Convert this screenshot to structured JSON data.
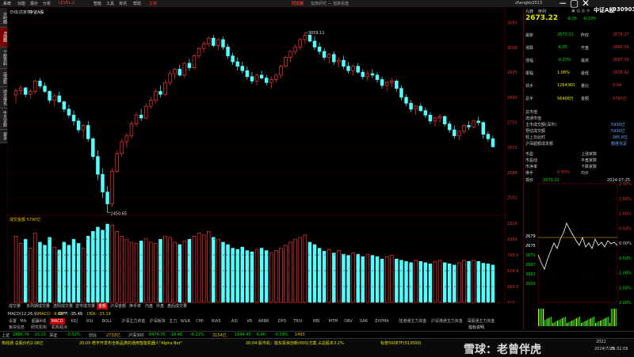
{
  "menubar": {
    "items": [
      "系统",
      "功能",
      "报价",
      "分析",
      "LEVEL-2",
      "智能",
      "工具",
      "资讯",
      "帮助",
      "主菜"
    ],
    "logo": "同花顺",
    "title": "指数研究 — 指数看盘",
    "user": "zhengkb2013",
    "right_tools": [
      "九转",
      "序列"
    ]
  },
  "left_tabs": [
    "分时图",
    "K线图",
    "个股资料",
    "自选股",
    "综合排名",
    "牛叉诊股",
    "更多"
  ],
  "chart": {
    "period_label": "日线(前复权)",
    "index_name": "中证A股",
    "y_ticks": [
      3093,
      3009,
      2925,
      2840,
      2755,
      2671,
      2586,
      2502
    ],
    "ylim": [
      2460,
      3110
    ],
    "high_label": "3059.11",
    "low_label": "2450.65",
    "volume_header": "成交金额 5790亿",
    "vol_ticks": [
      "1316",
      "1056",
      "795.0",
      "529.9",
      "265.0",
      "X10"
    ],
    "candles": [
      [
        2848,
        2870,
        2820,
        2862
      ],
      [
        2862,
        2880,
        2848,
        2872
      ],
      [
        2872,
        2875,
        2840,
        2850
      ],
      [
        2850,
        2868,
        2835,
        2860
      ],
      [
        2860,
        2900,
        2852,
        2895
      ],
      [
        2895,
        2905,
        2870,
        2878
      ],
      [
        2878,
        2890,
        2855,
        2860
      ],
      [
        2860,
        2865,
        2820,
        2830
      ],
      [
        2830,
        2852,
        2810,
        2845
      ],
      [
        2845,
        2860,
        2820,
        2825
      ],
      [
        2825,
        2830,
        2790,
        2800
      ],
      [
        2800,
        2815,
        2770,
        2780
      ],
      [
        2780,
        2795,
        2745,
        2760
      ],
      [
        2760,
        2770,
        2720,
        2730
      ],
      [
        2730,
        2752,
        2700,
        2745
      ],
      [
        2745,
        2760,
        2690,
        2700
      ],
      [
        2700,
        2705,
        2630,
        2640
      ],
      [
        2640,
        2660,
        2560,
        2580
      ],
      [
        2580,
        2600,
        2500,
        2520
      ],
      [
        2520,
        2540,
        2450,
        2480
      ],
      [
        2480,
        2600,
        2470,
        2590
      ],
      [
        2590,
        2660,
        2585,
        2650
      ],
      [
        2650,
        2700,
        2640,
        2690
      ],
      [
        2690,
        2720,
        2670,
        2710
      ],
      [
        2710,
        2760,
        2700,
        2750
      ],
      [
        2750,
        2790,
        2740,
        2780
      ],
      [
        2780,
        2800,
        2760,
        2770
      ],
      [
        2770,
        2820,
        2765,
        2810
      ],
      [
        2810,
        2840,
        2800,
        2830
      ],
      [
        2830,
        2870,
        2820,
        2860
      ],
      [
        2860,
        2880,
        2840,
        2850
      ],
      [
        2850,
        2900,
        2845,
        2890
      ],
      [
        2890,
        2930,
        2880,
        2920
      ],
      [
        2920,
        2940,
        2900,
        2935
      ],
      [
        2935,
        2950,
        2910,
        2915
      ],
      [
        2915,
        2960,
        2905,
        2955
      ],
      [
        2955,
        2970,
        2930,
        2940
      ],
      [
        2940,
        2985,
        2935,
        2980
      ],
      [
        2980,
        3010,
        2970,
        3005
      ],
      [
        3005,
        3030,
        2990,
        3020
      ],
      [
        3020,
        3045,
        3010,
        3040
      ],
      [
        3040,
        3050,
        3010,
        3015
      ],
      [
        3015,
        3040,
        3000,
        3035
      ],
      [
        3035,
        3045,
        3000,
        3010
      ],
      [
        3010,
        3020,
        2970,
        2980
      ],
      [
        2980,
        2990,
        2950,
        2960
      ],
      [
        2960,
        2975,
        2930,
        2945
      ],
      [
        2945,
        2960,
        2920,
        2930
      ],
      [
        2930,
        2945,
        2900,
        2910
      ],
      [
        2910,
        2925,
        2885,
        2895
      ],
      [
        2895,
        2920,
        2880,
        2915
      ],
      [
        2915,
        2930,
        2900,
        2905
      ],
      [
        2905,
        2915,
        2880,
        2890
      ],
      [
        2890,
        2910,
        2870,
        2900
      ],
      [
        2900,
        2920,
        2890,
        2915
      ],
      [
        2915,
        2950,
        2905,
        2945
      ],
      [
        2945,
        2980,
        2940,
        2975
      ],
      [
        2975,
        3000,
        2960,
        2995
      ],
      [
        2995,
        3020,
        2985,
        3010
      ],
      [
        3010,
        3040,
        3000,
        3035
      ],
      [
        3035,
        3059,
        3020,
        3050
      ],
      [
        3050,
        3055,
        3025,
        3030
      ],
      [
        3030,
        3045,
        3000,
        3010
      ],
      [
        3010,
        3025,
        2985,
        2995
      ],
      [
        2995,
        3005,
        2965,
        2975
      ],
      [
        2975,
        2990,
        2955,
        2985
      ],
      [
        2985,
        2995,
        2950,
        2960
      ],
      [
        2960,
        2975,
        2940,
        2965
      ],
      [
        2965,
        2980,
        2935,
        2945
      ],
      [
        2945,
        2960,
        2920,
        2930
      ],
      [
        2930,
        2950,
        2915,
        2945
      ],
      [
        2945,
        2955,
        2920,
        2925
      ],
      [
        2925,
        2935,
        2900,
        2910
      ],
      [
        2910,
        2930,
        2895,
        2920
      ],
      [
        2920,
        2935,
        2905,
        2915
      ],
      [
        2915,
        2925,
        2890,
        2900
      ],
      [
        2900,
        2910,
        2870,
        2880
      ],
      [
        2880,
        2895,
        2860,
        2890
      ],
      [
        2890,
        2905,
        2875,
        2895
      ],
      [
        2895,
        2900,
        2860,
        2870
      ],
      [
        2870,
        2880,
        2830,
        2840
      ],
      [
        2840,
        2850,
        2810,
        2820
      ],
      [
        2820,
        2830,
        2790,
        2800
      ],
      [
        2800,
        2815,
        2780,
        2810
      ],
      [
        2810,
        2820,
        2790,
        2795
      ],
      [
        2795,
        2805,
        2770,
        2780
      ],
      [
        2780,
        2790,
        2750,
        2760
      ],
      [
        2760,
        2775,
        2740,
        2770
      ],
      [
        2770,
        2785,
        2755,
        2775
      ],
      [
        2775,
        2780,
        2740,
        2750
      ],
      [
        2750,
        2760,
        2720,
        2730
      ],
      [
        2730,
        2745,
        2700,
        2710
      ],
      [
        2710,
        2730,
        2695,
        2725
      ],
      [
        2725,
        2750,
        2715,
        2745
      ],
      [
        2745,
        2760,
        2730,
        2740
      ],
      [
        2740,
        2765,
        2735,
        2760
      ],
      [
        2760,
        2775,
        2745,
        2755
      ],
      [
        2755,
        2760,
        2700,
        2715
      ],
      [
        2715,
        2725,
        2690,
        2700
      ],
      [
        2700,
        2710,
        2670,
        2673
      ]
    ],
    "volumes": [
      1100,
      980,
      1050,
      900,
      1150,
      1000,
      950,
      1080,
      920,
      870,
      1000,
      950,
      1050,
      980,
      900,
      1100,
      1180,
      1250,
      1200,
      1300,
      1280,
      1180,
      1100,
      1050,
      1000,
      980,
      1020,
      1060,
      1000,
      980,
      1050,
      1100,
      1080,
      1000,
      960,
      1020,
      1050,
      1100,
      1150,
      1120,
      1180,
      1080,
      1050,
      1000,
      960,
      900,
      880,
      920,
      860,
      840,
      880,
      900,
      860,
      820,
      860,
      900,
      950,
      1000,
      1050,
      1080,
      1120,
      1000,
      960,
      900,
      850,
      880,
      820,
      860,
      800,
      780,
      820,
      800,
      760,
      800,
      780,
      760,
      720,
      760,
      780,
      720,
      700,
      680,
      660,
      700,
      680,
      660,
      640,
      680,
      700,
      660,
      640,
      620,
      660,
      700,
      680,
      700,
      680,
      650,
      640,
      620
    ]
  },
  "tabs_row": {
    "items": [
      "成交量",
      "多周期成交量",
      "连阳成交量",
      "逆市成交量",
      "金额",
      "沪深金额",
      "换手率",
      "内盘",
      "外盘",
      "盘后成交量"
    ],
    "active": 4,
    "right": "指标说明"
  },
  "macd_row": {
    "label": "MACD(12,26,9)",
    "macd": "MACD: -9.60",
    "diff": "DIFF: -35.49",
    "dea": "DEA: -33.19"
  },
  "indicator_row": {
    "items": [
      "设置",
      "MA",
      "超赢K线",
      "MACD",
      "KDJ",
      "RSI",
      "BOLL",
      "沪深主力资金",
      "沪深板块",
      "主力",
      "W&R",
      "CMI",
      "BIAS",
      "ASI",
      "VR",
      "ARBR",
      "DPO",
      "TRIX",
      "BBI",
      "MTM",
      "OBV",
      "SAR",
      "EXPMA",
      "陆港通主力资金",
      "沪深港通主力资金",
      "深股通主力资金"
    ],
    "active": 3
  },
  "sub_row": {
    "items": [
      "板块信息",
      "研究机构",
      "机构观点"
    ]
  },
  "quote": {
    "price": "2673.22",
    "change": "-6.05",
    "pct": "-0.23%",
    "name": "中证A股",
    "code": "930903",
    "rows": [
      {
        "l1": "最新",
        "v1": "2673.22",
        "l2": "昨收",
        "v2": "2679.27"
      },
      {
        "l1": "涨跌",
        "v1": "-6.05",
        "l2": "开盘",
        "v2": "2666.39"
      },
      {
        "l1": "涨幅",
        "v1": "-0.23%",
        "l2": "最高",
        "v2": "2687.39"
      },
      {
        "l1": "振幅",
        "v1": "1.06%",
        "l2": "最低",
        "v2": "2658.92"
      },
      {
        "l1": "现手",
        "v1": "1264360",
        "l2": "量比",
        "v2": "0.94"
      },
      {
        "l1": "总手",
        "v1": "56408万",
        "l2": "金额",
        "v2": "5790亿"
      }
    ],
    "stats": [
      {
        "label": "总市值",
        "value": ""
      },
      {
        "label": "流通市值",
        "value": ""
      },
      {
        "label": "主市成交额(深市)",
        "value": "5930亿"
      },
      {
        "label": "预估成交额",
        "value": "5930亿"
      },
      {
        "label": "较上日此时",
        "value": "-385.8亿"
      },
      {
        "label": "沪深超额成本额",
        "value": "额度充足"
      }
    ],
    "ratios": [
      {
        "l1": "市盈",
        "v1": "",
        "l2": "上涨家数",
        "v2": ""
      },
      {
        "l1": "市盈动",
        "v1": "",
        "l2": "平盘家数",
        "v2": ""
      },
      {
        "l1": "市净率",
        "v1": "",
        "l2": "下跌家数",
        "v2": ""
      },
      {
        "l1": "换手",
        "v1": "0.95%",
        "l2": "均价",
        "v2": ""
      }
    ]
  },
  "mini": {
    "label": "现价",
    "price": "2673.22",
    "date": "2024-07-25",
    "pcts": [
      "2.00%",
      "1.50%",
      "1.00%",
      "0.50%",
      "0.00%",
      "0.50%",
      "1.00%",
      "1.50%",
      "2.00%"
    ],
    "levels": [
      "2679",
      "2675",
      "2671",
      "2667",
      "2663",
      "2659"
    ]
  },
  "ticker": {
    "items": [
      {
        "t": "上证",
        "v": "2886.74",
        "c": "-15.21"
      },
      {
        "t": "深证",
        "v": "",
        "c": "-0.52%"
      },
      {
        "t": "创业",
        "v": "2733亿"
      },
      {
        "t": "沪深300",
        "v": "8474.70",
        "c": "-18.48"
      },
      {
        "t": "",
        "v": "",
        "c": "-0.22%"
      },
      {
        "t": "",
        "v": "3154亿"
      },
      {
        "t": "",
        "v": "1644.45",
        "c": "-6.46"
      },
      {
        "t": "",
        "v": "",
        "c": "-0.39%"
      },
      {
        "t": "",
        "v": "1493"
      }
    ]
  },
  "status": {
    "news1": "热线通 总股价约2.06亿",
    "news2": "20:05 皓宇开发布全新品类的通用智能机器人\"Alpha Bot\"",
    "news3": "20:04 股市机：能东投资创新(600)方案 占总股本3.2%",
    "news4": "标普500ETF(513500)",
    "brand": "雪球：老曾伴虎",
    "time": "2024/7/25",
    "clock": "20:31:09",
    "zoom": "2021"
  }
}
